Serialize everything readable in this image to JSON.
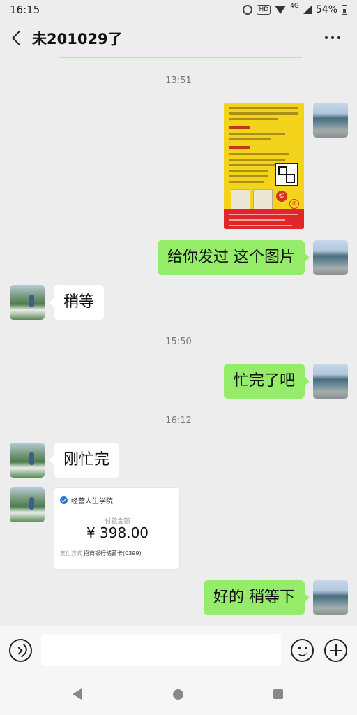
{
  "status_bar": {
    "time": "16:15",
    "hd_label": "HD",
    "network_label": "4G",
    "battery": "54%"
  },
  "header": {
    "title": "未201029了"
  },
  "messages": {
    "time_1": "13:51",
    "msg_text_1": "给你发过 这个图片",
    "msg_text_2": "稍等",
    "time_2": "15:50",
    "msg_text_3": "忙完了吧",
    "time_3": "16:12",
    "msg_text_4": "刚忙完",
    "msg_text_5": "好的 稍等下"
  },
  "transfer": {
    "merchant": "经营人生学院",
    "label": "付款金额",
    "amount": "¥ 398.00",
    "method_label": "支付方式",
    "method_value": "招商银行储蓄卡(0399)"
  },
  "input": {
    "placeholder": ""
  },
  "icons": {
    "back": "back-arrow-icon",
    "more": "more-icon",
    "voice": "voice-icon",
    "emoji": "emoji-icon",
    "plus": "plus-icon"
  },
  "colors": {
    "my_bubble": "#95ec69",
    "other_bubble": "#ffffff",
    "chat_background": "#ededed"
  }
}
